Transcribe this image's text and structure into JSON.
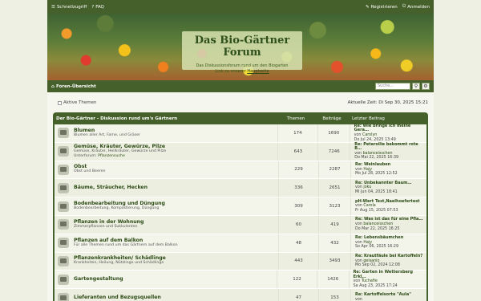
{
  "topnav": {
    "left": [
      "Schnellzugriff",
      "FAQ"
    ],
    "right": [
      "Registrieren",
      "Anmelden"
    ]
  },
  "banner": {
    "title": "Das Bio-Gärtner Forum",
    "subtitle": "Das Diskussionsforum rund um den Biogarten",
    "link_prefix": "Link zu unserer",
    "link": "Hauptseite"
  },
  "subnav": {
    "home": "Foren-Übersicht",
    "search_placeholder": "Suche…"
  },
  "active_topics": "Aktive Themen",
  "current_time": "Aktuelle Zeit: Di Sep 30, 2025 15:21",
  "forum": {
    "category": "Der Bio-Gärtner - Diskussion rund um's Gärtnern",
    "col_topics": "Themen",
    "col_posts": "Beiträge",
    "col_last": "Letzter Beitrag",
    "rows": [
      {
        "name": "Blumen",
        "desc": "Blumen aller Art, Farne, und Gräser",
        "topics": "174",
        "posts": "1690",
        "last_title": "Re: Wie bringe ich meine Gera…",
        "by": "von",
        "author": "Carolyn",
        "date": "Do Jul 24, 2025 13:49"
      },
      {
        "name": "Gemüse, Kräuter, Gewürze, Pilze",
        "desc": "Gemüse, Kräuter, Heilkräuter, Gewürze und Pilze",
        "sub": "Unterforum:",
        "sublink": "Pflanzensuche",
        "topics": "643",
        "posts": "7246",
        "last_title": "Re: Petersilie bekommt rote B…",
        "by": "von",
        "author": "balanceisschen",
        "date": "Do Mai 22, 2025 16:39"
      },
      {
        "name": "Obst",
        "desc": "Obst und Beeren",
        "topics": "229",
        "posts": "2287",
        "last_title": "Re: Weinlauben",
        "by": "von",
        "author": "Hajy",
        "date": "Mo Jul 28, 2025 12:52"
      },
      {
        "name": "Bäume, Sträucher, Hecken",
        "desc": "",
        "topics": "336",
        "posts": "2651",
        "last_title": "Re: Unbekannter Baum…",
        "by": "von",
        "author": "joku",
        "date": "Mi Jun 04, 2025 18:41"
      },
      {
        "name": "Bodenbearbeitung und Düngung",
        "desc": "Bodenbearbeitung, Kompostierung, Düngung",
        "topics": "309",
        "posts": "3123",
        "last_title": "pH-Wert Test,Naelhoefertest",
        "by": "von",
        "author": "Carola",
        "date": "Fr Aug 15, 2025 07:53"
      },
      {
        "name": "Pflanzen in der Wohnung",
        "desc": "Zimmerpflanzen und Sukkulenten",
        "topics": "60",
        "posts": "419",
        "last_title": "Re: Was ist das für eine Pfla…",
        "by": "von",
        "author": "balanceisschen",
        "date": "Do Mar 22, 2025 16:25"
      },
      {
        "name": "Pflanzen auf dem Balkon",
        "desc": "Für alle Themen rund um das Gärtnern auf dem Balkon",
        "topics": "48",
        "posts": "432",
        "last_title": "Re: Lebensbäumchen",
        "by": "von",
        "author": "Hajy",
        "date": "So Apr 06, 2025 16:29"
      },
      {
        "name": "Pflanzenkrankheiten/ Schädlinge",
        "desc": "Krankheiten, Heilung, Nützlinge und Schädlinge",
        "topics": "443",
        "posts": "3493",
        "last_title": "Re: Krautfäule bei Kartoffeln?",
        "by": "von",
        "author": "geisanio",
        "date": "Mo Sep 02, 2024 12:08"
      },
      {
        "name": "Gartengestaltung",
        "desc": "",
        "topics": "122",
        "posts": "1426",
        "last_title": "Re: Garten in Wettersberg Erkl…",
        "by": "von",
        "author": "Tuchafie",
        "date": "Sa Aug 23, 2025 17:24"
      },
      {
        "name": "Lieferanten und Bezugsquellen",
        "desc": "",
        "topics": "47",
        "posts": "153",
        "last_title": "Re: Kartoffelsorte \"Aula\"",
        "by": "von",
        "author": "",
        "date": ""
      }
    ]
  }
}
